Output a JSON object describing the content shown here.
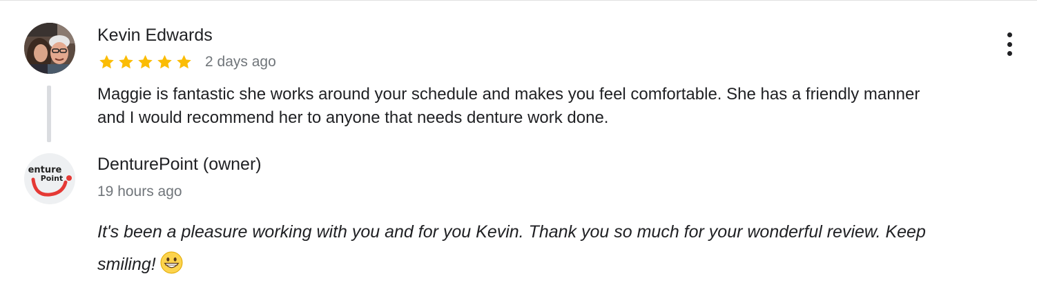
{
  "review": {
    "reviewer_name": "Kevin Edwards",
    "rating": 5,
    "rating_max": 5,
    "date": "2 days ago",
    "text": "Maggie is fantastic she works around your schedule and makes you feel comfortable. She has a friendly manner and I would recommend her to anyone that needs denture work done.",
    "avatar_icon": "reviewer-photo-icon",
    "more_icon": "more-vert-icon",
    "star_color": "#fbbc04"
  },
  "owner_response": {
    "name": "DenturePoint (owner)",
    "date": "19 hours ago",
    "text": "It's been a pleasure working with you and for you Kevin. Thank you so much for your wonderful review. Keep smiling!",
    "emoji": "grinning-face-emoji",
    "logo_text": "Denture Point",
    "logo_accent": "#e53935"
  },
  "colors": {
    "primary_text": "#202124",
    "secondary_text": "#70757a",
    "thread_line": "#dadce0"
  }
}
